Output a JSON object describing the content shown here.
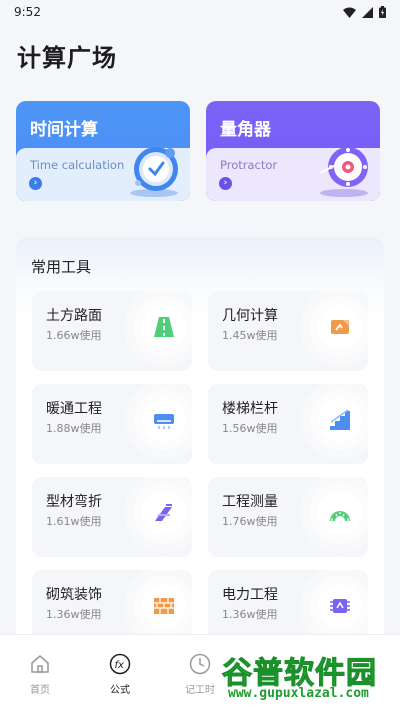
{
  "status_bar": {
    "time": "9:52"
  },
  "page_title": "计算广场",
  "feature_cards": [
    {
      "title": "时间计算",
      "subtitle": "Time calculation",
      "arrow": "›"
    },
    {
      "title": "量角器",
      "subtitle": "Protractor",
      "arrow": "›"
    }
  ],
  "tools_section": {
    "title": "常用工具",
    "tools": [
      {
        "name": "土方路面",
        "usage": "1.66w使用",
        "icon": "road-icon",
        "color": "#4fcf7a"
      },
      {
        "name": "几何计算",
        "usage": "1.45w使用",
        "icon": "geometry-box-icon",
        "color": "#f19a4a"
      },
      {
        "name": "暖通工程",
        "usage": "1.88w使用",
        "icon": "air-conditioner-icon",
        "color": "#4d8ef2"
      },
      {
        "name": "楼梯栏杆",
        "usage": "1.56w使用",
        "icon": "stairs-icon",
        "color": "#4d8ef2"
      },
      {
        "name": "型材弯折",
        "usage": "1.61w使用",
        "icon": "profile-bend-icon",
        "color": "#7a63f2"
      },
      {
        "name": "工程测量",
        "usage": "1.76w使用",
        "icon": "protractor-measure-icon",
        "color": "#4fcf7a"
      },
      {
        "name": "砌筑装饰",
        "usage": "1.36w使用",
        "icon": "brick-wall-icon",
        "color": "#f19a4a"
      },
      {
        "name": "电力工程",
        "usage": "1.36w使用",
        "icon": "circuit-chip-icon",
        "color": "#7a63f2"
      }
    ]
  },
  "bottom_nav": [
    {
      "label": "首页",
      "icon": "home-icon"
    },
    {
      "label": "公式",
      "icon": "fx-icon"
    },
    {
      "label": "记工时",
      "icon": "clock-icon"
    }
  ],
  "watermark": {
    "text": "谷普软件园",
    "url": "www.gupuxlazal.com"
  }
}
